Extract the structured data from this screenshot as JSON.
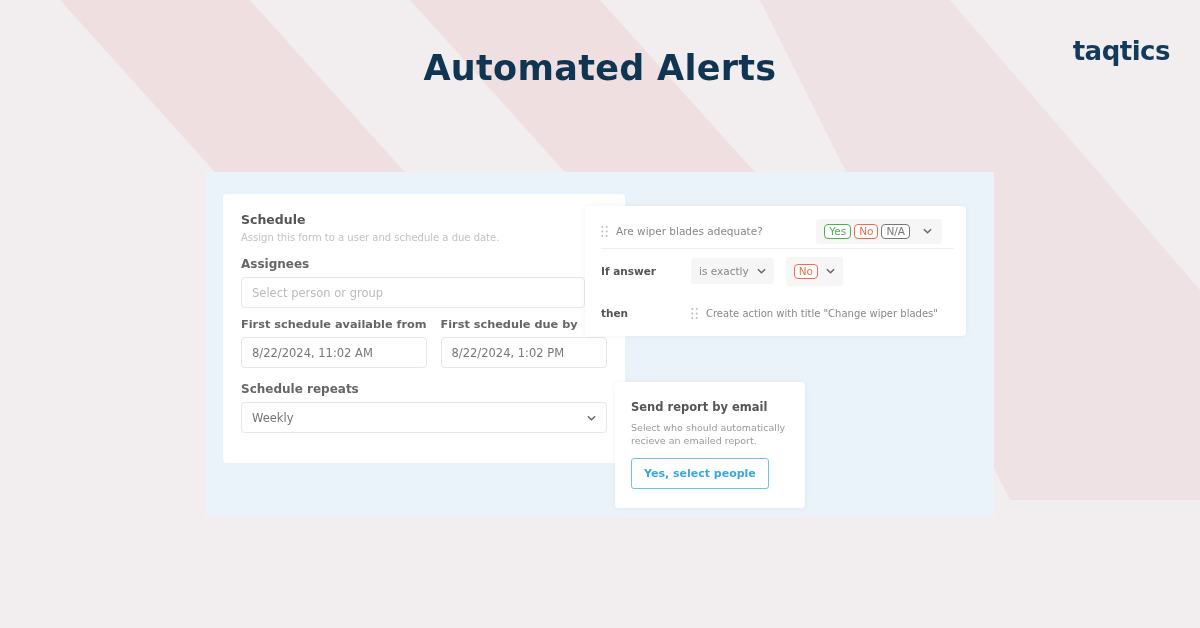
{
  "title": "Automated Alerts",
  "logo": "taqtics",
  "schedule": {
    "title": "Schedule",
    "subtitle": "Assign this form to a user and schedule a due date.",
    "assignees": {
      "label": "Assignees",
      "placeholder": "Select person or group"
    },
    "available_from": {
      "label": "First schedule available from",
      "value": "8/22/2024, 11:02 AM"
    },
    "due_by": {
      "label": "First schedule due by",
      "value": "8/22/2024, 1:02 PM"
    },
    "repeats": {
      "label": "Schedule repeats",
      "value": "Weekly"
    }
  },
  "rule": {
    "question": "Are wiper blades adequate?",
    "responses": [
      {
        "label": "Yes",
        "color": "#4caf50"
      },
      {
        "label": "No",
        "color": "#f26b4f"
      },
      {
        "label": "N/A",
        "color": "#777777"
      }
    ],
    "condition_label": "If answer",
    "operator": "is exactly",
    "answer": {
      "label": "No",
      "color": "#f26b4f"
    },
    "then_label": "then",
    "action": "Create action with title \"Change wiper blades\""
  },
  "email": {
    "title": "Send report by email",
    "description": "Select who should automatically recieve an emailed report.",
    "button": "Yes, select people"
  }
}
